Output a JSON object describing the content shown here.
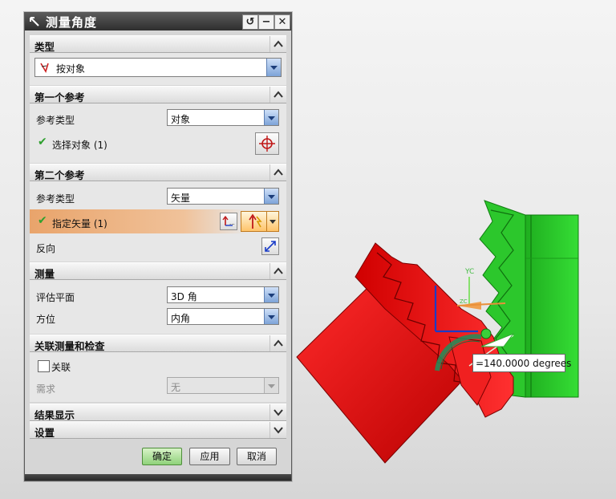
{
  "dialog": {
    "title": "测量角度",
    "buttons": {
      "reset": "↺",
      "minimize": "−",
      "close": "✕"
    }
  },
  "type_section": {
    "title": "类型",
    "value": "按对象"
  },
  "first_ref": {
    "title": "第一个参考",
    "ref_type_label": "参考类型",
    "ref_type_value": "对象",
    "select_label": "选择对象 (1)"
  },
  "second_ref": {
    "title": "第二个参考",
    "ref_type_label": "参考类型",
    "ref_type_value": "矢量",
    "specify_label": "指定矢量 (1)",
    "reverse_label": "反向"
  },
  "measure": {
    "title": "测量",
    "eval_plane_label": "评估平面",
    "eval_plane_value": "3D 角",
    "orientation_label": "方位",
    "orientation_value": "内角"
  },
  "assoc": {
    "title": "关联测量和检查",
    "assoc_label": "关联",
    "require_label": "需求",
    "require_value": "无"
  },
  "result_display": {
    "title": "结果显示"
  },
  "settings": {
    "title": "设置"
  },
  "actions": {
    "ok": "确定",
    "apply": "应用",
    "cancel": "取消"
  },
  "viewport": {
    "angle_readout": "=140.0000 degrees",
    "yc_label": "YC",
    "zc_label": "ZC",
    "colors": {
      "red_part": "#e01010",
      "green_part": "#22cc22",
      "highlight": "#e9a46b"
    }
  }
}
